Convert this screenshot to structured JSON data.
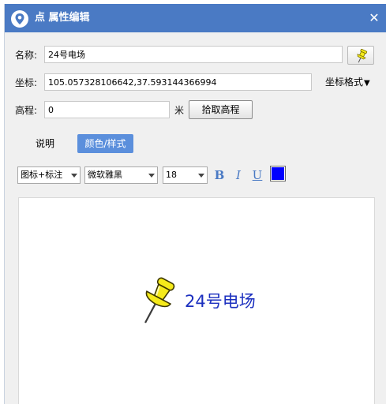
{
  "window": {
    "title": "点 属性编辑",
    "close_glyph": "✕"
  },
  "form": {
    "name_label": "名称:",
    "name_value": "24号电场",
    "coord_label": "坐标:",
    "coord_value": "105.057328106642,37.593144366994",
    "coord_format_label": "坐标格式",
    "coord_format_arrow": "▼",
    "elevation_label": "高程:",
    "elevation_value": "0",
    "elevation_unit": "米",
    "fetch_elevation_button": "拾取高程"
  },
  "tabs": [
    {
      "label": "说明",
      "active": false
    },
    {
      "label": "颜色/样式",
      "active": true
    }
  ],
  "style_toolbar": {
    "display_mode": "图标+标注",
    "font_family": "微软雅黑",
    "font_size": "18",
    "bold_label": "B",
    "italic_label": "I",
    "underline_label": "U",
    "text_color": "#0000ff"
  },
  "preview": {
    "label_text": "24号电场",
    "label_color": "#1b2fbf",
    "icon": "yellow-pushpin-icon"
  },
  "colors": {
    "titlebar": "#4a7ac4",
    "active_tab": "#5b8fdc",
    "pin_yellow": "#f5ea1a"
  }
}
